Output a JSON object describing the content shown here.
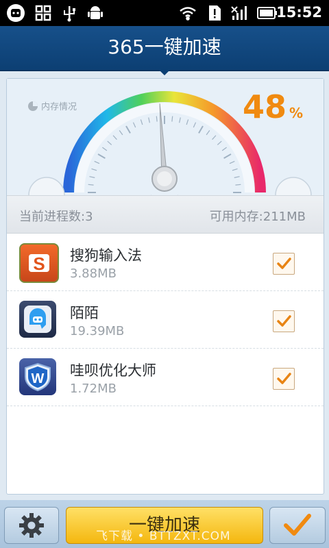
{
  "status_bar": {
    "time": "15:52",
    "icons": [
      "app-bubble-icon",
      "grid-icon",
      "usb-icon",
      "android-debug-icon",
      "wifi-icon",
      "sd-card-alert-icon",
      "no-signal-icon",
      "battery-icon"
    ]
  },
  "header": {
    "title": "365一键加速"
  },
  "memory": {
    "label": "内存情况",
    "percent_value": "48",
    "percent_unit": "%",
    "gauge_fraction": 0.48
  },
  "stats": {
    "process_count": "当前进程数:3",
    "available_memory": "可用内存:211MB"
  },
  "apps": [
    {
      "name": "搜狗输入法",
      "size": "3.88MB",
      "checked": true,
      "icon": "sogou-icon"
    },
    {
      "name": "陌陌",
      "size": "19.39MB",
      "checked": true,
      "icon": "momo-icon"
    },
    {
      "name": "哇呗优化大师",
      "size": "1.72MB",
      "checked": true,
      "icon": "wabei-shield-icon"
    }
  ],
  "bottom": {
    "speed_button": "一键加速",
    "settings_icon": "gear-icon",
    "confirm_icon": "checkmark-icon",
    "watermark": "飞下载 • BTTZXT.COM"
  },
  "colors": {
    "header": "#0c3f73",
    "percent": "#f08a10",
    "primary_button": "#f4b70f"
  }
}
